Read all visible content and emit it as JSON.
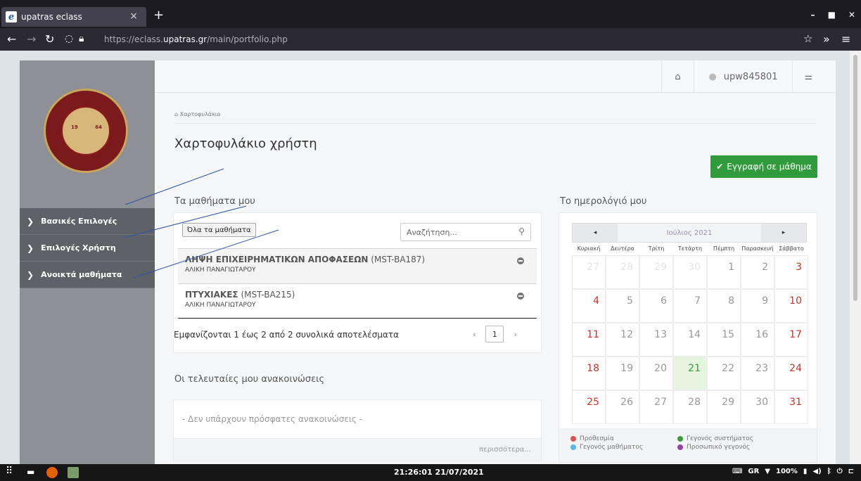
{
  "browser": {
    "tab_title": "upatras eclass",
    "tab_close": "×",
    "new_tab": "+",
    "url_prefix": "https://eclass.",
    "url_domain": "upatras.gr",
    "url_path": "/main/portfolio.php"
  },
  "topbar": {
    "username": "upw845801"
  },
  "logo": {
    "year_left": "19",
    "year_right": "64"
  },
  "sidebar": {
    "items": [
      {
        "label": "Βασικές Επιλογές"
      },
      {
        "label": "Επιλογές Χρήστη"
      },
      {
        "label": "Ανοικτά μαθήματα"
      }
    ]
  },
  "breadcrumb": "Χαρτοφυλάκιο",
  "page_title": "Χαρτοφυλάκιο χρήστη",
  "enroll_button": "Εγγραφή σε μάθημα",
  "courses": {
    "heading": "Τα μαθήματα μου",
    "all_button": "Όλα τα μαθήματα",
    "search_placeholder": "Αναζήτηση...",
    "items": [
      {
        "title": "ΛΗΨΗ ΕΠΙΧΕΙΡΗΜΑΤΙΚΩΝ ΑΠΟΦΑΣΕΩΝ",
        "code": "(MST-BA187)",
        "professor": "ΑΛΙΚΗ ΠΑΝΑΓΙΩΤΑΡΟΥ"
      },
      {
        "title": "ΠΤΥΧΙΑΚΕΣ",
        "code": "(MST-BA215)",
        "professor": "ΑΛΙΚΗ ΠΑΝΑΓΙΩΤΑΡΟΥ"
      }
    ],
    "results_text": "Εμφανίζονται 1 έως 2 από 2 συνολικά αποτελέσματα",
    "pager_prev": "‹",
    "pager_current": "1",
    "pager_next": "›"
  },
  "announcements": {
    "heading": "Οι τελευταίες μου ανακοινώσεις",
    "empty_text": "- Δεν υπάρχουν πρόσφατες ανακοινώσεις -",
    "more_link": "περισσότερα..."
  },
  "calendar": {
    "heading": "Το ημερολόγιό μου",
    "prev": "◂",
    "next": "▸",
    "month": "Ιούλιος 2021",
    "weekdays": [
      "Κυριακή",
      "Δευτέρα",
      "Τρίτη",
      "Τετάρτη",
      "Πέμπτη",
      "Παρασκευή",
      "Σάββατο"
    ],
    "weeks": [
      [
        "27",
        "28",
        "29",
        "30",
        "1",
        "2",
        "3"
      ],
      [
        "4",
        "5",
        "6",
        "7",
        "8",
        "9",
        "10"
      ],
      [
        "11",
        "12",
        "13",
        "14",
        "15",
        "16",
        "17"
      ],
      [
        "18",
        "19",
        "20",
        "21",
        "22",
        "23",
        "24"
      ],
      [
        "25",
        "26",
        "27",
        "28",
        "29",
        "30",
        "31"
      ]
    ],
    "today": "21",
    "legend": [
      {
        "label": "Προθεσμία",
        "color": "#d9534f"
      },
      {
        "label": "Γεγονός μαθήματος",
        "color": "#5bb5e8"
      },
      {
        "label": "Γεγονός συστήματος",
        "color": "#3c9a3c"
      },
      {
        "label": "Προσωπικό γεγονός",
        "color": "#9b3ea8"
      }
    ]
  },
  "taskbar": {
    "clock": "21:26:01 21/07/2021",
    "lang": "GR",
    "battery": "100%"
  }
}
